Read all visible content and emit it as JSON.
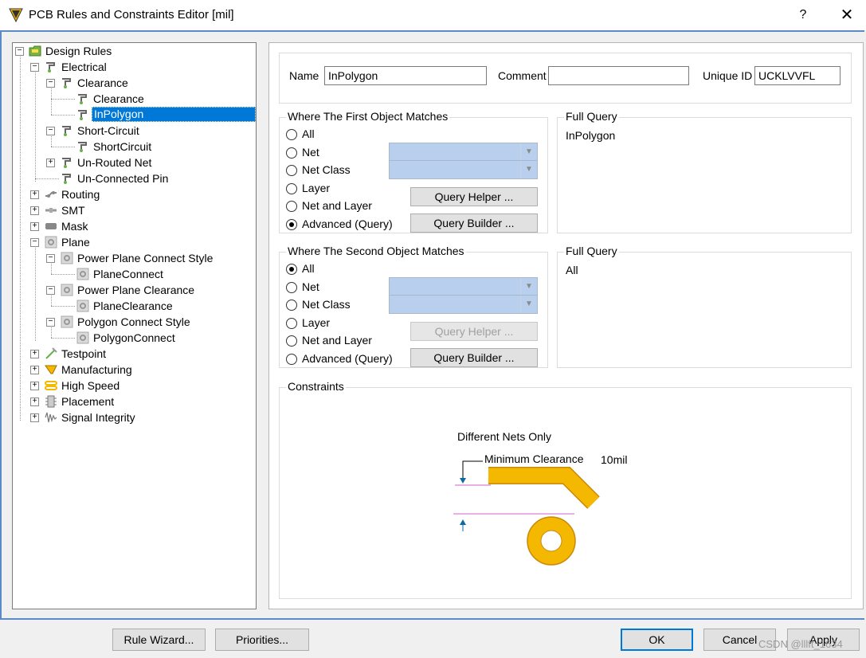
{
  "window": {
    "title": "PCB Rules and Constraints Editor [mil]",
    "help": "?",
    "close": "✕"
  },
  "tree": {
    "nodes": [
      {
        "label": "Design Rules"
      },
      {
        "label": "Electrical"
      },
      {
        "label": "Clearance"
      },
      {
        "label": "Clearance"
      },
      {
        "label": "InPolygon",
        "selected": true
      },
      {
        "label": "Short-Circuit"
      },
      {
        "label": "ShortCircuit"
      },
      {
        "label": "Un-Routed Net"
      },
      {
        "label": "Un-Connected Pin"
      },
      {
        "label": "Routing"
      },
      {
        "label": "SMT"
      },
      {
        "label": "Mask"
      },
      {
        "label": "Plane"
      },
      {
        "label": "Power Plane Connect Style"
      },
      {
        "label": "PlaneConnect"
      },
      {
        "label": "Power Plane Clearance"
      },
      {
        "label": "PlaneClearance"
      },
      {
        "label": "Polygon Connect Style"
      },
      {
        "label": "PolygonConnect"
      },
      {
        "label": "Testpoint"
      },
      {
        "label": "Manufacturing"
      },
      {
        "label": "High Speed"
      },
      {
        "label": "Placement"
      },
      {
        "label": "Signal Integrity"
      }
    ]
  },
  "rule": {
    "name_label": "Name",
    "name_value": "InPolygon",
    "comment_label": "Comment",
    "comment_value": "",
    "uid_label": "Unique ID",
    "uid_value": "UCKLVVFL"
  },
  "first": {
    "title": "Where The First Object Matches",
    "options": [
      "All",
      "Net",
      "Net Class",
      "Layer",
      "Net and Layer",
      "Advanced (Query)"
    ],
    "selected": "Advanced (Query)",
    "query_helper": "Query Helper ...",
    "query_builder": "Query Builder ...",
    "full_query_title": "Full Query",
    "full_query": "InPolygon"
  },
  "second": {
    "title": "Where The Second Object Matches",
    "options": [
      "All",
      "Net",
      "Net Class",
      "Layer",
      "Net and Layer",
      "Advanced (Query)"
    ],
    "selected": "All",
    "query_helper": "Query Helper ...",
    "query_builder": "Query Builder ...",
    "full_query_title": "Full Query",
    "full_query": "All"
  },
  "constraints": {
    "title": "Constraints",
    "scope": "Different Nets Only",
    "min_clearance_label": "Minimum Clearance",
    "min_clearance_value": "10mil"
  },
  "footer": {
    "rule_wizard": "Rule Wizard...",
    "priorities": "Priorities...",
    "ok": "OK",
    "cancel": "Cancel",
    "apply": "Apply",
    "watermark": "CSDN @lllft_1634"
  },
  "colors": {
    "selection": "#0078d7",
    "combo_disabled": "#b8d0ee",
    "track": "#f5b800",
    "frame": "#5a8bc8"
  }
}
